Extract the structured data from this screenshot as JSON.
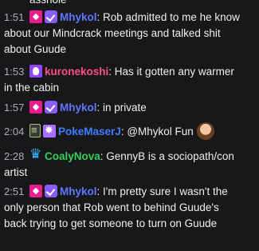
{
  "top_fragment": "asshole",
  "messages": [
    {
      "time": "1:51",
      "user": "Mhykol",
      "user_color": "#5e77ff",
      "text": "Rob admitted to me he know about our Mindcrack meetings and talked shit about Guude"
    },
    {
      "time": "1:53",
      "user": "kuronekoshi",
      "user_color": "#ff4f8b",
      "text": "Has it gotten any warmer in the cabin"
    },
    {
      "time": "1:57",
      "user": "Mhykol",
      "user_color": "#5e77ff",
      "text": "in private"
    },
    {
      "time": "2:04",
      "user": "PokeMaserJ",
      "user_color": "#3d7dff",
      "text": "@Mhykol Fun"
    },
    {
      "time": "2:28",
      "user": "CoalyNova",
      "user_color": "#32d25a",
      "text": "GennyB is a sociopath/con artist"
    },
    {
      "time": "2:51",
      "user": "Mhykol",
      "user_color": "#5e77ff",
      "text": "I'm pretty sure I wasn't the only person that Rob went to behind Guude's back trying to get someone to turn on Guude"
    }
  ]
}
